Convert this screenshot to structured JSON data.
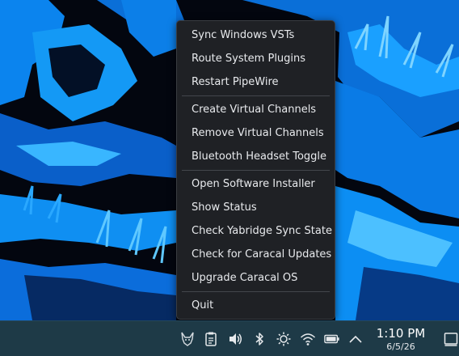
{
  "menu": {
    "groups": [
      [
        "Sync Windows VSTs",
        "Route System Plugins",
        "Restart PipeWire"
      ],
      [
        "Create Virtual Channels",
        "Remove Virtual Channels",
        "Bluetooth Headset Toggle"
      ],
      [
        "Open Software Installer",
        "Show Status",
        "Check Yabridge Sync State",
        "Check for Caracal Updates",
        "Upgrade Caracal OS"
      ],
      [
        "Quit"
      ]
    ]
  },
  "taskbar": {
    "tray_icons": [
      "caracal-app-icon",
      "clipboard-icon",
      "volume-icon",
      "bluetooth-icon",
      "brightness-icon",
      "wifi-icon",
      "battery-icon",
      "chevron-up-icon"
    ],
    "clock_time": "1:10 PM",
    "clock_date": "6/5/26",
    "show_desktop_icon": "show-desktop-icon"
  },
  "colors": {
    "menu_bg": "#1f2125",
    "menu_text": "#e8eaed",
    "taskbar_bg": "#1e3a47",
    "wallpaper_blue": "#0a8ff0",
    "wallpaper_dark": "#03060f"
  }
}
